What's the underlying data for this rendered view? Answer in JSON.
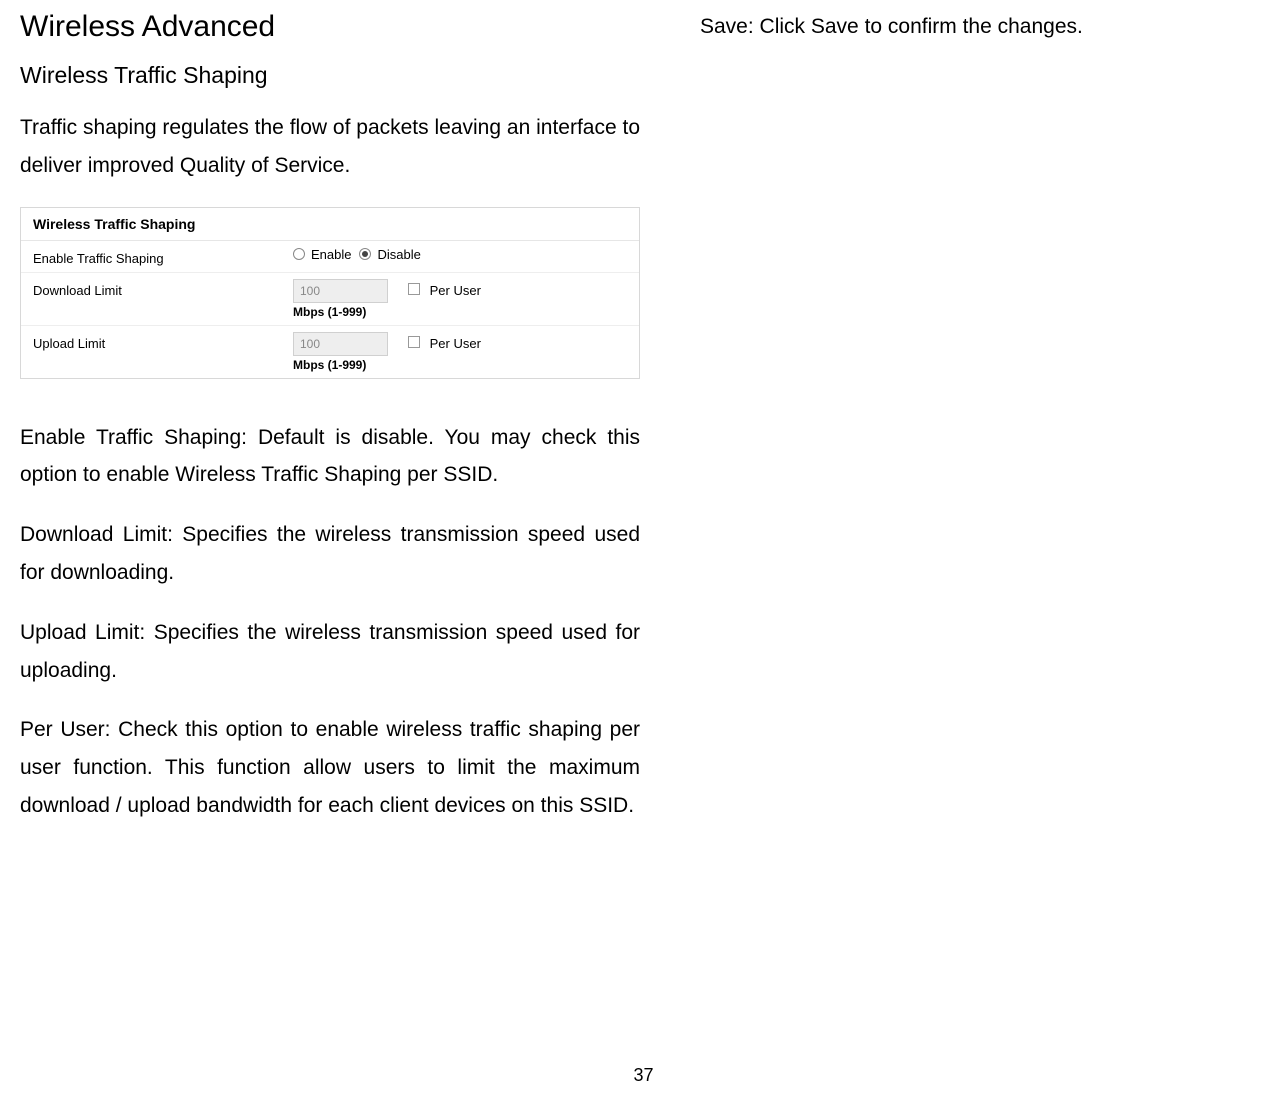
{
  "heading": "Wireless Advanced",
  "subheading": "Wireless Traffic Shaping",
  "intro": "Traffic shaping regulates the flow of packets leaving an interface to deliver improved Quality of Service.",
  "config": {
    "panel_title": "Wireless Traffic Shaping",
    "rows": {
      "enable": {
        "label": "Enable Traffic Shaping",
        "option_enable": "Enable",
        "option_disable": "Disable"
      },
      "download": {
        "label": "Download Limit",
        "value": "100",
        "hint": "Mbps (1-999)",
        "per_user": "Per User"
      },
      "upload": {
        "label": "Upload Limit",
        "value": "100",
        "hint": "Mbps (1-999)",
        "per_user": "Per User"
      }
    }
  },
  "paragraphs": {
    "enable_desc": "Enable Traffic Shaping: Default is disable. You may check this option to enable Wireless Traffic Shaping per SSID.",
    "download_desc": "Download Limit: Specifies the wireless transmission speed used for downloading.",
    "upload_desc": "Upload Limit: Specifies the wireless transmission speed used for uploading.",
    "peruser_desc": "Per User: Check this option to enable wireless traffic shaping per user function. This function allow users to limit the maximum download / upload bandwidth for each client devices on this SSID."
  },
  "right_text": "Save: Click Save to confirm the changes.",
  "page_number": "37"
}
